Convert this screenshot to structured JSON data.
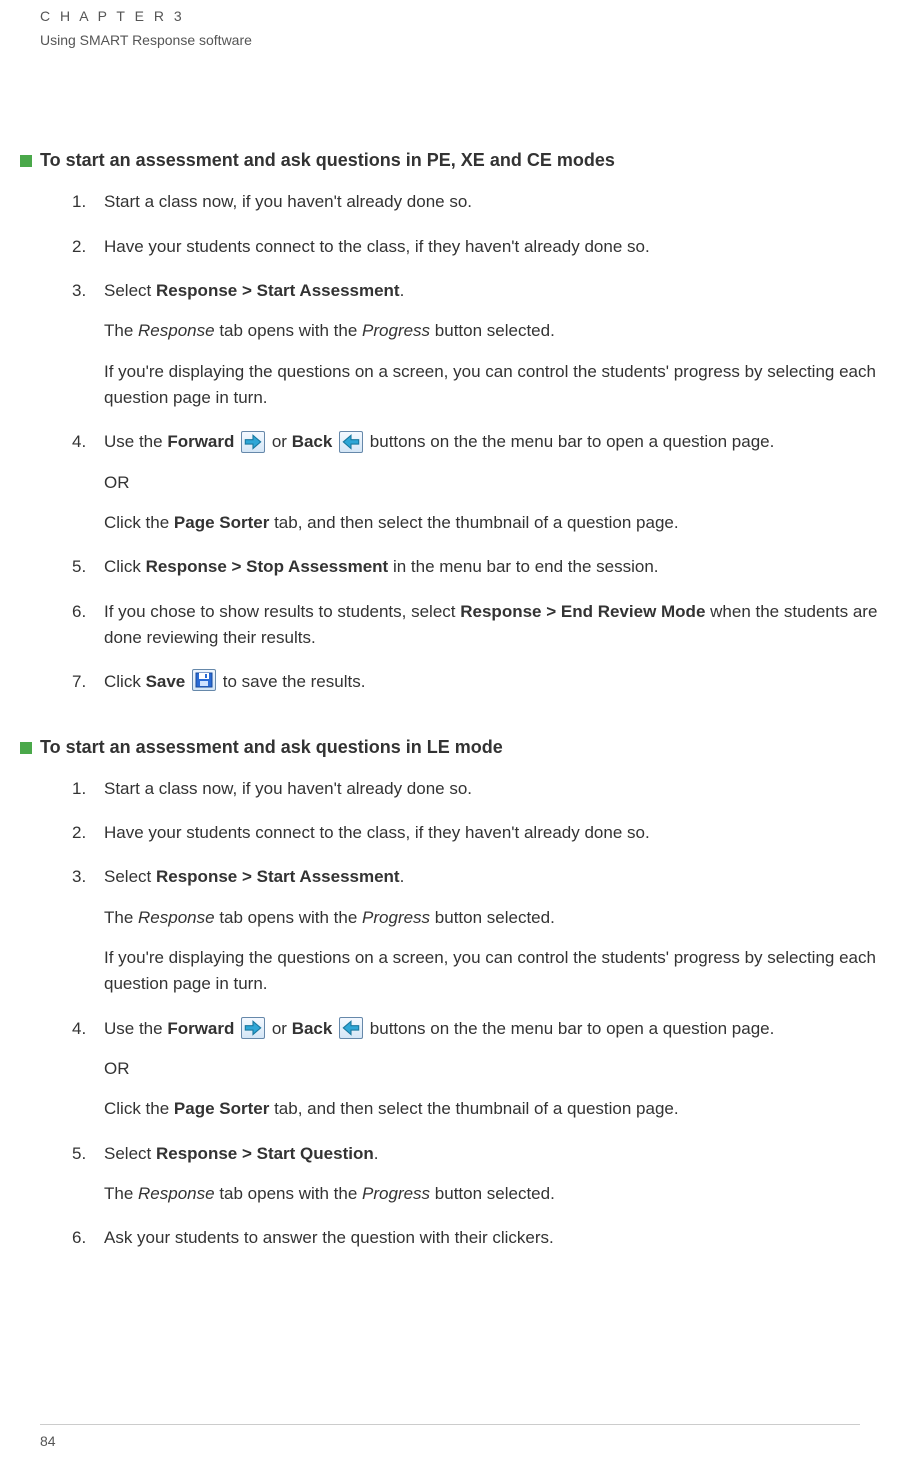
{
  "header": {
    "chapter_label": "C H A P T E R  3",
    "chapter_subtitle": "Using SMART Response software"
  },
  "section1": {
    "heading": "To start an assessment and ask questions in PE, XE and CE modes",
    "steps": [
      {
        "p1": "Start a class now, if you haven't already done so."
      },
      {
        "p1": "Have your students connect to the class, if they haven't already done so."
      },
      {
        "p1_pre": "Select ",
        "p1_bold": "Response > Start Assessment",
        "p1_post": ".",
        "p2_pre": "The ",
        "p2_i1": "Response",
        "p2_mid": " tab opens with the ",
        "p2_i2": "Progress",
        "p2_post": " button selected.",
        "p3": "If you're displaying the questions on a screen, you can control the students' progress by selecting each question page in turn."
      },
      {
        "p1_a": "Use the ",
        "p1_b": "Forward",
        "p1_c": " or ",
        "p1_d": "Back",
        "p1_e": " buttons on the the menu bar to open a question page.",
        "p2": "OR",
        "p3_a": "Click the ",
        "p3_b": "Page Sorter",
        "p3_c": " tab, and then select the thumbnail of a question page."
      },
      {
        "p1_a": "Click ",
        "p1_b": "Response > Stop Assessment",
        "p1_c": " in the menu bar to end the session."
      },
      {
        "p1_a": "If you chose to show results to students, select ",
        "p1_b": "Response > End Review Mode",
        "p1_c": " when the students are done reviewing their results."
      },
      {
        "p1_a": "Click ",
        "p1_b": "Save",
        "p1_c": " to save the results."
      }
    ]
  },
  "section2": {
    "heading": "To start an assessment and ask questions in LE mode",
    "steps": [
      {
        "p1": "Start a class now, if you haven't already done so."
      },
      {
        "p1": "Have your students connect to the class, if they haven't already done so."
      },
      {
        "p1_pre": "Select ",
        "p1_bold": "Response > Start Assessment",
        "p1_post": ".",
        "p2_pre": "The ",
        "p2_i1": "Response",
        "p2_mid": " tab opens with the ",
        "p2_i2": "Progress",
        "p2_post": " button selected.",
        "p3": "If you're displaying the questions on a screen, you can control the students' progress by selecting each question page in turn."
      },
      {
        "p1_a": "Use the ",
        "p1_b": "Forward",
        "p1_c": " or ",
        "p1_d": "Back",
        "p1_e": " buttons on the the menu bar to open a question page.",
        "p2": "OR",
        "p3_a": "Click the ",
        "p3_b": "Page Sorter",
        "p3_c": " tab, and then select the thumbnail of a question page."
      },
      {
        "p1_a": "Select ",
        "p1_b": "Response > Start Question",
        "p1_c": ".",
        "p2_pre": "The ",
        "p2_i1": "Response",
        "p2_mid": " tab opens with the ",
        "p2_i2": "Progress",
        "p2_post": " button selected."
      },
      {
        "p1": "Ask your students to answer the question with their clickers."
      }
    ]
  },
  "page_number": "84"
}
